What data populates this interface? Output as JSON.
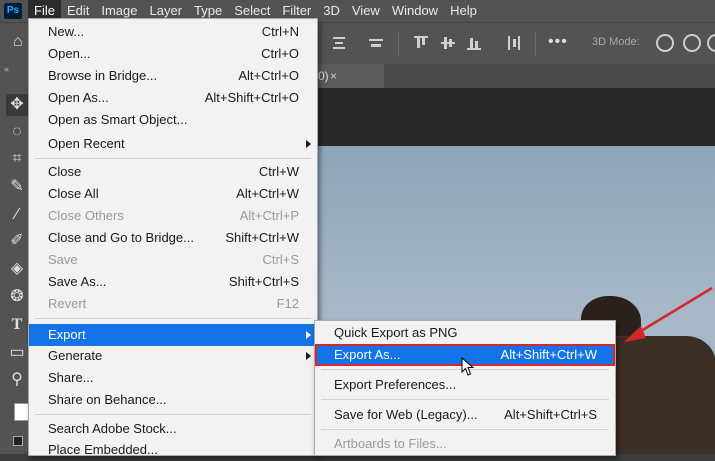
{
  "menubar": {
    "logo": "Ps",
    "items": [
      "File",
      "Edit",
      "Image",
      "Layer",
      "Type",
      "Select",
      "Filter",
      "3D",
      "View",
      "Window",
      "Help"
    ],
    "active": "File"
  },
  "options_bar": {
    "more": "•••",
    "mode_label": "3D Mode:"
  },
  "toolbar": {
    "collapse": "«",
    "tools": [
      "move-icon",
      "lasso-icon",
      "crop-icon",
      "eyedropper-icon",
      "brush-icon",
      "healing-icon",
      "paint-bucket-icon",
      "sponge-icon",
      "type-icon",
      "rectangle-icon",
      "zoom-icon"
    ]
  },
  "document_tab": {
    "partial": "0)",
    "close": "×"
  },
  "file_menu": {
    "items": [
      {
        "label": "New...",
        "shortcut": "Ctrl+N"
      },
      {
        "label": "Open...",
        "shortcut": "Ctrl+O"
      },
      {
        "label": "Browse in Bridge...",
        "shortcut": "Alt+Ctrl+O"
      },
      {
        "label": "Open As...",
        "shortcut": "Alt+Shift+Ctrl+O"
      },
      {
        "label": "Open as Smart Object...",
        "shortcut": ""
      },
      {
        "label": "Open Recent",
        "shortcut": "",
        "submenu": true
      },
      {
        "label": "Close",
        "shortcut": "Ctrl+W"
      },
      {
        "label": "Close All",
        "shortcut": "Alt+Ctrl+W"
      },
      {
        "label": "Close Others",
        "shortcut": "Alt+Ctrl+P",
        "disabled": true
      },
      {
        "label": "Close and Go to Bridge...",
        "shortcut": "Shift+Ctrl+W"
      },
      {
        "label": "Save",
        "shortcut": "Ctrl+S",
        "disabled": true
      },
      {
        "label": "Save As...",
        "shortcut": "Shift+Ctrl+S"
      },
      {
        "label": "Revert",
        "shortcut": "F12",
        "disabled": true
      },
      {
        "label": "Export",
        "shortcut": "",
        "submenu": true,
        "highlighted": true
      },
      {
        "label": "Generate",
        "shortcut": "",
        "submenu": true
      },
      {
        "label": "Share...",
        "shortcut": ""
      },
      {
        "label": "Share on Behance...",
        "shortcut": ""
      },
      {
        "label": "Search Adobe Stock...",
        "shortcut": ""
      },
      {
        "label": "Place Embedded...",
        "shortcut": ""
      }
    ]
  },
  "export_submenu": {
    "items": [
      {
        "label": "Quick Export as PNG",
        "shortcut": ""
      },
      {
        "label": "Export As...",
        "shortcut": "Alt+Shift+Ctrl+W",
        "highlighted": true
      },
      {
        "label": "Export Preferences...",
        "shortcut": ""
      },
      {
        "label": "Save for Web (Legacy)...",
        "shortcut": "Alt+Shift+Ctrl+S"
      },
      {
        "label": "Artboards to Files...",
        "shortcut": "",
        "disabled": true
      }
    ]
  },
  "colors": {
    "highlight": "#1473e6",
    "annotation": "#d6262b",
    "menu_bg": "#f2f2f2",
    "chrome": "#535353"
  }
}
